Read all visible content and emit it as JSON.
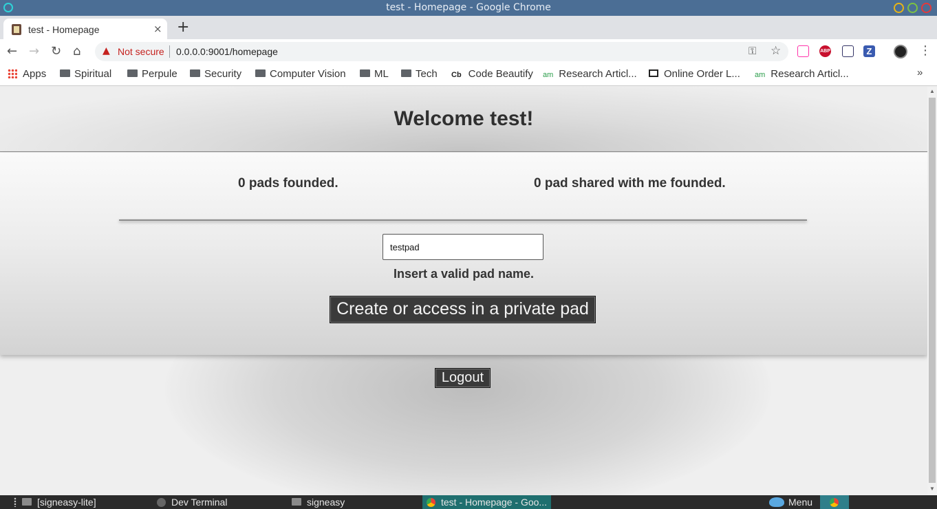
{
  "window": {
    "title": "test - Homepage - Google Chrome"
  },
  "tab": {
    "title": "test - Homepage",
    "close": "×",
    "new_tab": "+"
  },
  "toolbar": {
    "back": "←",
    "forward": "→",
    "reload": "↻",
    "home": "⌂",
    "security_label": "Not secure",
    "url": "0.0.0.0:9001/homepage",
    "menu": "⋮"
  },
  "bookmarks": {
    "apps": "Apps",
    "items": [
      {
        "label": "Spiritual",
        "icon": "folder-icon"
      },
      {
        "label": "Perpule",
        "icon": "folder-icon"
      },
      {
        "label": "Security",
        "icon": "folder-icon"
      },
      {
        "label": "Computer Vision",
        "icon": "folder-icon"
      },
      {
        "label": "ML",
        "icon": "folder-icon"
      },
      {
        "label": "Tech",
        "icon": "folder-icon"
      },
      {
        "label": "Code Beautify",
        "icon": "cb-icon",
        "icon_text": "Cb"
      },
      {
        "label": "Research Articl...",
        "icon": "am-icon",
        "icon_text": "am"
      },
      {
        "label": "Online Order L...",
        "icon": "computer-icon"
      },
      {
        "label": "Research Articl...",
        "icon": "am-icon",
        "icon_text": "am"
      }
    ],
    "more": "»"
  },
  "extensions": [
    "ABP",
    "Z"
  ],
  "page": {
    "welcome": "Welcome test!",
    "pads_count": "0 pads founded.",
    "shared_count": "0 pad shared with me founded.",
    "pad_input_value": "testpad",
    "hint": "Insert a valid pad name.",
    "create_button": "Create or access in a private pad",
    "logout_button": "Logout"
  },
  "taskbar": {
    "items": [
      {
        "label": "[signeasy-lite]"
      },
      {
        "label": "Dev Terminal"
      },
      {
        "label": "signeasy"
      },
      {
        "label": "test - Homepage - Goo..."
      }
    ],
    "menu": "Menu"
  }
}
